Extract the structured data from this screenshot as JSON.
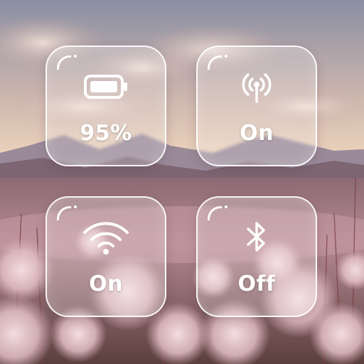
{
  "tiles": {
    "battery": {
      "value": "95%",
      "level": 0.95,
      "icon": "battery-icon"
    },
    "cellular": {
      "value": "On",
      "icon": "antenna-icon"
    },
    "wifi": {
      "value": "On",
      "icon": "wifi-icon"
    },
    "bluetooth": {
      "value": "Off",
      "icon": "bluetooth-icon"
    }
  },
  "colors": {
    "tile_border": "#ffffff",
    "text": "#ffffff"
  }
}
